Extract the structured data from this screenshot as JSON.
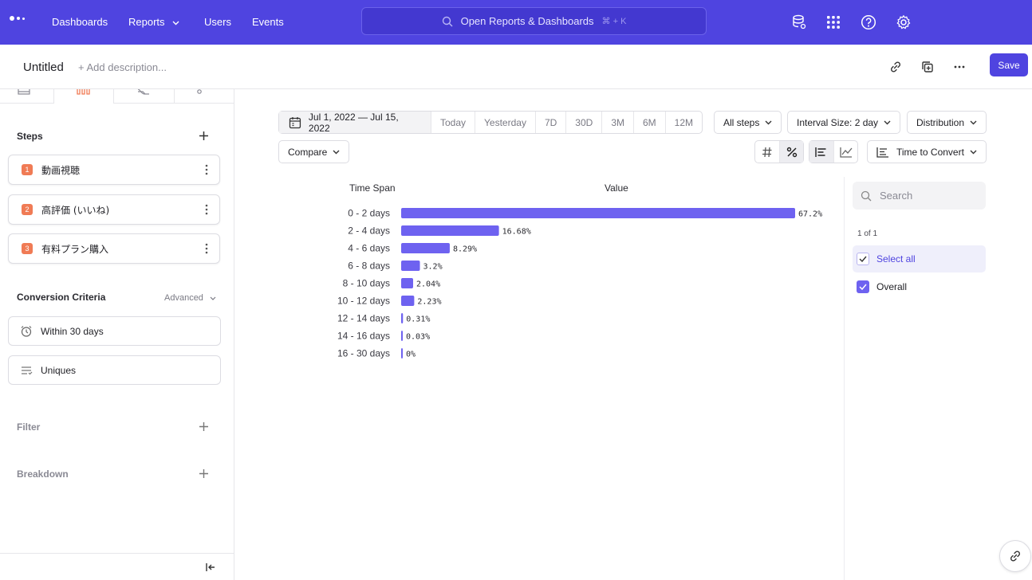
{
  "nav": {
    "links": [
      "Dashboards",
      "Reports",
      "Users",
      "Events"
    ],
    "search_placeholder": "Open Reports & Dashboards",
    "search_shortcut": "⌘ + K",
    "icons": [
      "data-stack-icon",
      "app-grid-icon",
      "help-icon",
      "gear-icon"
    ]
  },
  "titlebar": {
    "title": "Untitled",
    "add_description": "+ Add description...",
    "save_label": "Save"
  },
  "sidebar": {
    "steps_title": "Steps",
    "steps": [
      {
        "num": "1",
        "label": "動画視聴"
      },
      {
        "num": "2",
        "label": "高評価 (いいね)"
      },
      {
        "num": "3",
        "label": "有料プラン購入"
      }
    ],
    "criteria_title": "Conversion Criteria",
    "advanced_label": "Advanced",
    "criteria": [
      {
        "label": "Within 30 days",
        "icon": "alarm-clock-icon"
      },
      {
        "label": "Uniques",
        "icon": "uniques-filter-icon"
      }
    ],
    "filter_title": "Filter",
    "breakdown_title": "Breakdown"
  },
  "controls": {
    "date_range": "Jul 1, 2022 — Jul 15, 2022",
    "date_presets": [
      "Today",
      "Yesterday",
      "7D",
      "30D",
      "3M",
      "6M",
      "12M"
    ],
    "all_steps": "All steps",
    "interval": "Interval Size: 2 day",
    "distribution": "Distribution",
    "compare": "Compare",
    "time_to_convert": "Time to Convert"
  },
  "chart_data": {
    "type": "bar",
    "orientation": "horizontal",
    "column_headers": [
      "Time Span",
      "Value"
    ],
    "categories": [
      "0 - 2 days",
      "2 - 4 days",
      "4 - 6 days",
      "6 - 8 days",
      "8 - 10 days",
      "10 - 12 days",
      "12 - 14 days",
      "14 - 16 days",
      "16 - 30 days"
    ],
    "values": [
      67.2,
      16.68,
      8.29,
      3.2,
      2.04,
      2.23,
      0.31,
      0.03,
      0
    ],
    "value_labels": [
      "67.2%",
      "16.68%",
      "8.29%",
      "3.2%",
      "2.04%",
      "2.23%",
      "0.31%",
      "0.03%",
      "0%"
    ],
    "xlim": [
      0,
      67.2
    ],
    "color": "#6e62f0"
  },
  "legend": {
    "search_placeholder": "Search",
    "count": "1 of 1",
    "select_all": "Select all",
    "items": [
      "Overall"
    ]
  },
  "colors": {
    "nav_bg": "#4f44e0",
    "bar": "#6e62f0",
    "step_badge": "#f07b55"
  }
}
